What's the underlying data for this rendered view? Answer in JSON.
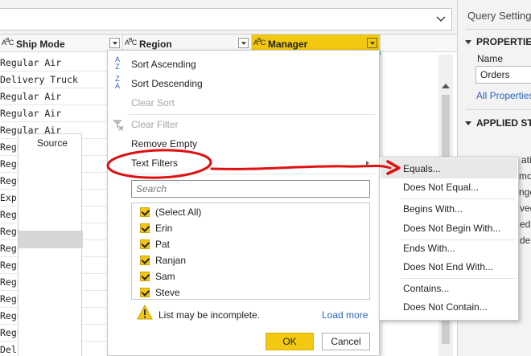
{
  "grid": {
    "columns": [
      {
        "type": "ABC",
        "name": "Ship Mode"
      },
      {
        "type": "ABC",
        "name": "Region"
      },
      {
        "type": "ABC",
        "name": "Manager"
      }
    ],
    "ship_mode_rows": [
      "Regular Air",
      "Delivery Truck",
      "Regular Air",
      "Regular Air",
      "Regular Air",
      "Regular Air",
      "Regular Air",
      "Regular Air",
      "Express Air",
      "Regular Air",
      "Regular Air",
      "Regular Air",
      "Regular Air",
      "Regular Air",
      "Regular Air",
      "Regular Air",
      "Regular Air",
      "Delivery Truck"
    ]
  },
  "settings": {
    "title": "Query Settings",
    "properties_head": "PROPERTIES",
    "name_label": "Name",
    "name_value": "Orders",
    "all_properties": "All Properties",
    "applied_steps_head": "APPLIED STEPS",
    "step_source": "Source",
    "step_fragments": [
      "atio",
      "mote",
      "nged",
      "ved",
      "ed",
      "de"
    ]
  },
  "filter_menu": {
    "sort_ascending": "Sort Ascending",
    "sort_descending": "Sort Descending",
    "clear_sort": "Clear Sort",
    "clear_filter": "Clear Filter",
    "remove_empty": "Remove Empty",
    "text_filters": "Text Filters",
    "search_placeholder": "Search",
    "values": [
      "(Select All)",
      "Erin",
      "Pat",
      "Ranjan",
      "Sam",
      "Steve"
    ],
    "warning": "List may be incomplete.",
    "load_more": "Load more",
    "ok": "OK",
    "cancel": "Cancel"
  },
  "text_submenu": {
    "items": [
      "Equals...",
      "Does Not Equal...",
      "Begins With...",
      "Does Not Begin With...",
      "Ends With...",
      "Does Not End With...",
      "Contains...",
      "Does Not Contain..."
    ]
  },
  "colors": {
    "accent": "#f2c811",
    "teal": "#1aa79b",
    "link": "#2b64b5",
    "annotation": "#e01010"
  }
}
